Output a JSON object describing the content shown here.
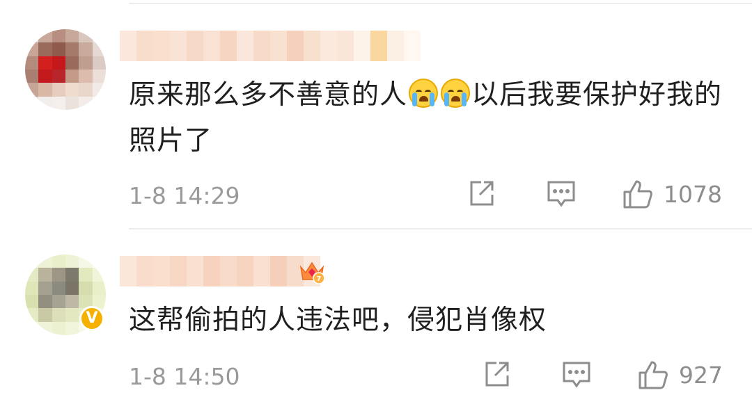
{
  "comments": [
    {
      "text_before": "原来那么多不善意的人",
      "emojis": [
        "crying-emoji",
        "crying-emoji"
      ],
      "text_after": "以后我要保护好我的照片了",
      "time": "1-8 14:29",
      "likes": "1078",
      "avatar_verified": false,
      "has_badge": false
    },
    {
      "text_before": "这帮偷拍的人违法吧，侵犯肖像权",
      "emojis": [],
      "text_after": "",
      "time": "1-8 14:50",
      "likes": "927",
      "avatar_verified": true,
      "has_badge": true
    }
  ],
  "colors": {
    "text": "#1f1f1f",
    "meta": "#9a9a9a",
    "icon": "#8d8d8d",
    "divider": "#ededed",
    "verified": "#f5b000"
  },
  "icons": [
    "share-icon",
    "reply-icon",
    "like-icon"
  ]
}
